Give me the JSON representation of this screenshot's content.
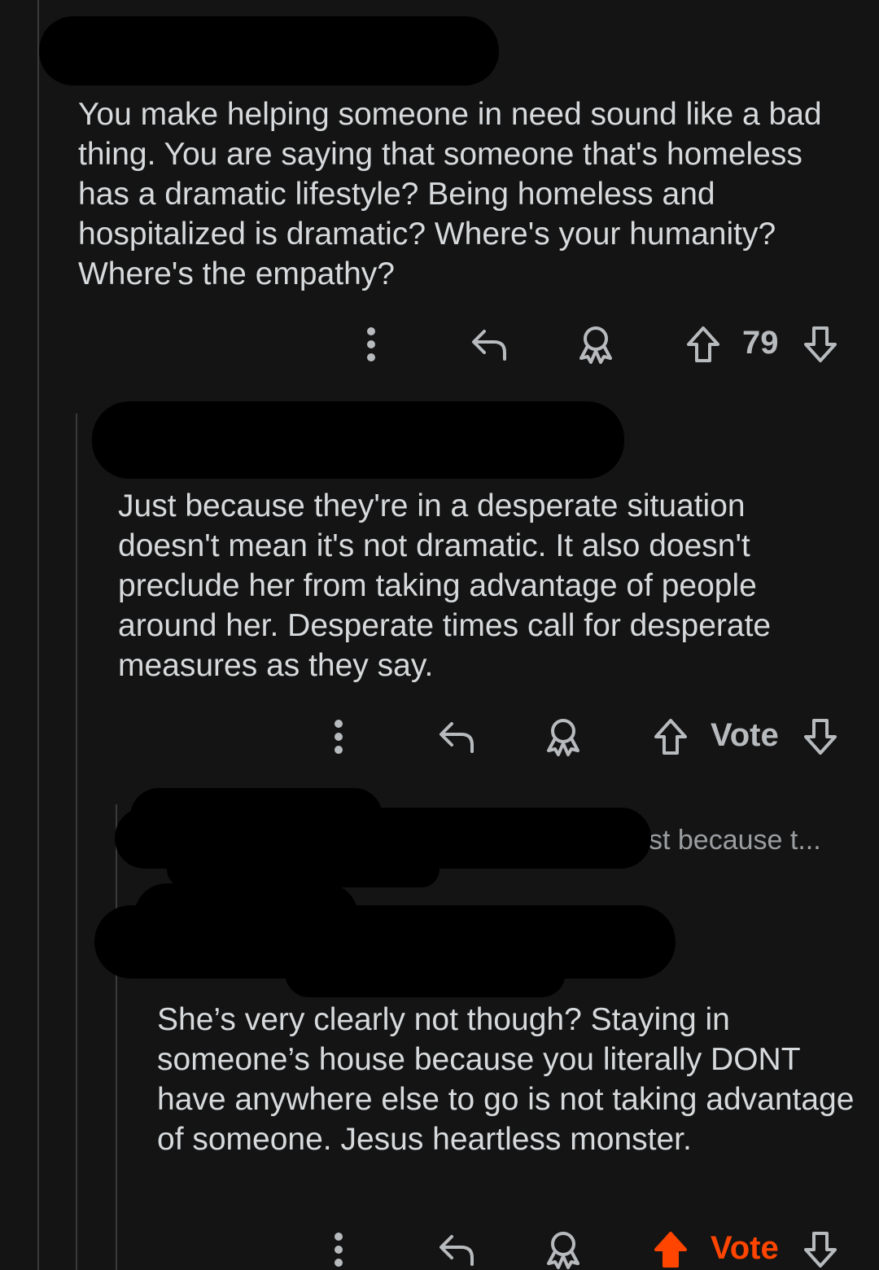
{
  "comments": [
    {
      "body": "You make helping someone in need sound like a bad thing. You are saying that someone that's homeless has a dramatic lifestyle?  Being homeless and hospitalized is dramatic? Where's your humanity? Where's the empathy?",
      "score": "79",
      "voted": false
    },
    {
      "body": "Just because they're in a desperate situation doesn't mean it's not dramatic. It also doesn't preclude her from taking advantage of people around her. Desperate times call for desperate measures as they say.",
      "score": "Vote",
      "voted": false
    },
    {
      "parent_preview": "st because t...",
      "body": "She’s very clearly not though? Staying in someone’s house because you literally DONT have anywhere else to go is not taking advantage of someone. Jesus heartless monster.",
      "score": "Vote",
      "voted": true
    }
  ],
  "icons": {
    "more": "more-vertical-icon",
    "reply": "reply-icon",
    "award": "award-icon",
    "upvote": "upvote-icon",
    "downvote": "downvote-icon"
  },
  "colors": {
    "background": "#141414",
    "text": "#d7dadc",
    "muted": "#b8bbbe",
    "upvote_active": "#ff4500",
    "redaction": "#000000"
  }
}
